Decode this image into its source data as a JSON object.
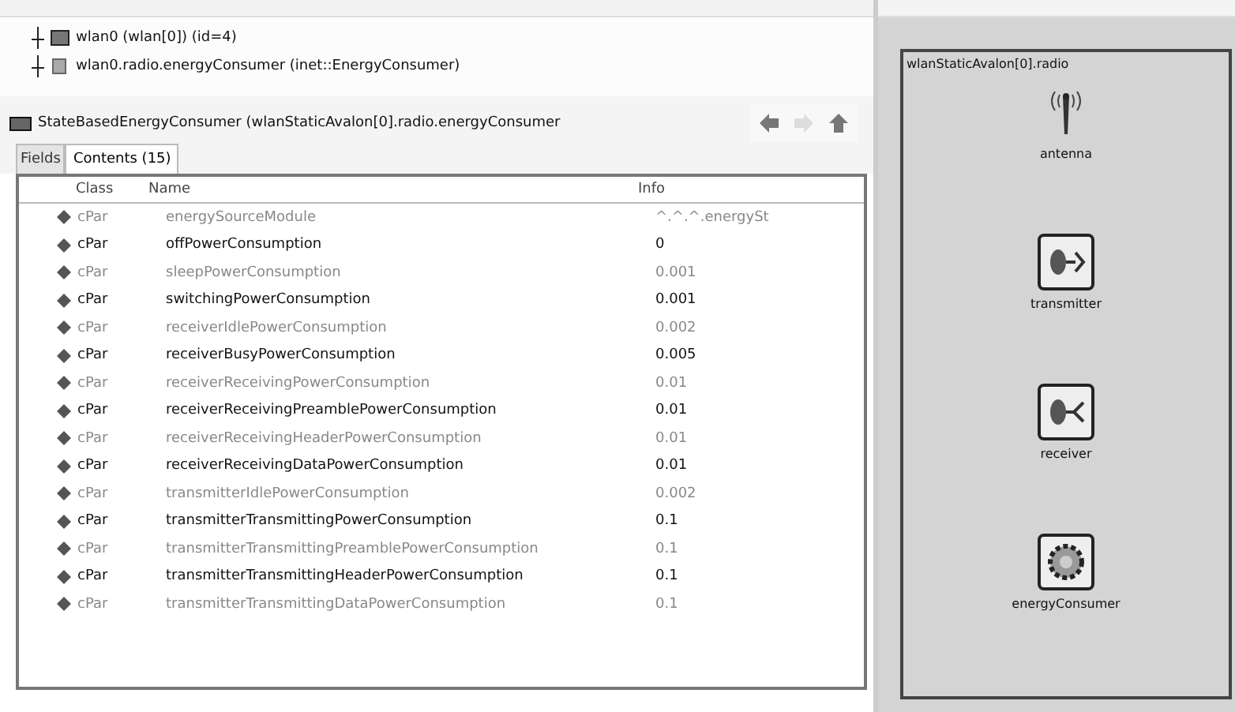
{
  "tree": [
    {
      "label": "wlan0 (wlan[0]) (id=4)"
    },
    {
      "label": "wlan0.radio.energyConsumer (inet::EnergyConsumer)"
    }
  ],
  "breadcrumb": "StateBasedEnergyConsumer (wlanStaticAvalon[0].radio.energyConsumer",
  "nav": [
    {
      "kind": "back",
      "disabled": false
    },
    {
      "kind": "forward",
      "disabled": true
    },
    {
      "kind": "up",
      "disabled": false
    }
  ],
  "tabs": [
    {
      "label": "Fields",
      "selected": false
    },
    {
      "label": "Contents (15)",
      "selected": true
    }
  ],
  "table": {
    "columns": [
      "Class",
      "Name",
      "Info"
    ],
    "rows": [
      {
        "class": "cPar",
        "name": "energySourceModule",
        "info": "^.^.^.energySt",
        "greyed": true
      },
      {
        "class": "cPar",
        "name": "offPowerConsumption",
        "info": "0",
        "greyed": false
      },
      {
        "class": "cPar",
        "name": "sleepPowerConsumption",
        "info": "0.001",
        "greyed": true
      },
      {
        "class": "cPar",
        "name": "switchingPowerConsumption",
        "info": "0.001",
        "greyed": false
      },
      {
        "class": "cPar",
        "name": "receiverIdlePowerConsumption",
        "info": "0.002",
        "greyed": true
      },
      {
        "class": "cPar",
        "name": "receiverBusyPowerConsumption",
        "info": "0.005",
        "greyed": false
      },
      {
        "class": "cPar",
        "name": "receiverReceivingPowerConsumption",
        "info": "0.01",
        "greyed": true
      },
      {
        "class": "cPar",
        "name": "receiverReceivingPreamblePowerConsumption",
        "info": "0.01",
        "greyed": false
      },
      {
        "class": "cPar",
        "name": "receiverReceivingHeaderPowerConsumption",
        "info": "0.01",
        "greyed": true
      },
      {
        "class": "cPar",
        "name": "receiverReceivingDataPowerConsumption",
        "info": "0.01",
        "greyed": false
      },
      {
        "class": "cPar",
        "name": "transmitterIdlePowerConsumption",
        "info": "0.002",
        "greyed": true
      },
      {
        "class": "cPar",
        "name": "transmitterTransmittingPowerConsumption",
        "info": "0.1",
        "greyed": false
      },
      {
        "class": "cPar",
        "name": "transmitterTransmittingPreamblePowerConsumption",
        "info": "0.1",
        "greyed": true
      },
      {
        "class": "cPar",
        "name": "transmitterTransmittingHeaderPowerConsumption",
        "info": "0.1",
        "greyed": false
      },
      {
        "class": "cPar",
        "name": "transmitterTransmittingDataPowerConsumption",
        "info": "0.1",
        "greyed": true
      }
    ]
  },
  "module": {
    "title": "wlanStaticAvalon[0].radio",
    "submodules": [
      {
        "kind": "antenna",
        "label": "antenna"
      },
      {
        "kind": "transmitter",
        "label": "transmitter"
      },
      {
        "kind": "receiver",
        "label": "receiver"
      },
      {
        "kind": "energy",
        "label": "energyConsumer"
      }
    ]
  }
}
